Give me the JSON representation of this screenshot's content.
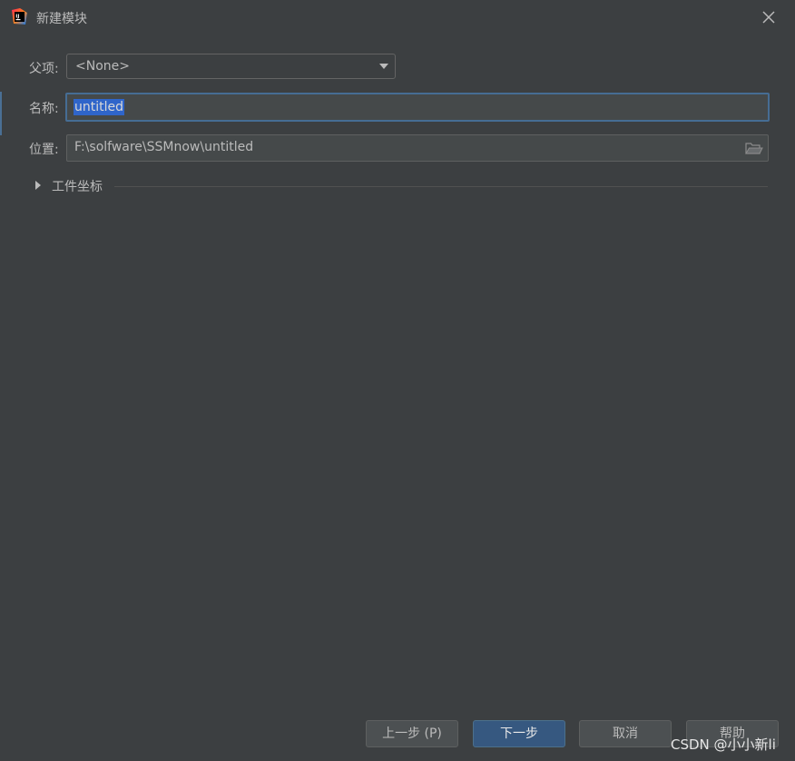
{
  "window": {
    "title": "新建模块",
    "app_icon": "intellij-idea-icon",
    "close_icon": "close-icon"
  },
  "form": {
    "parent": {
      "label": "父项:",
      "value": "<None>"
    },
    "name": {
      "label": "名称:",
      "value": "untitled"
    },
    "location": {
      "label": "位置:",
      "value": "F:\\solfware\\SSMnow\\untitled",
      "browse_icon": "folder-open-icon"
    },
    "artifact_section": {
      "label": "工件坐标",
      "expanded": false,
      "icon": "triangle-right-icon"
    }
  },
  "footer": {
    "previous_label": "上一步 (P)",
    "next_label": "下一步",
    "cancel_label": "取消",
    "help_label": "帮助"
  },
  "watermark": {
    "text": "CSDN @小小新li"
  },
  "colors": {
    "background": "#3c3f41",
    "primary_button": "#365880",
    "focus_border": "#466d94",
    "selection": "#2f65ca"
  }
}
